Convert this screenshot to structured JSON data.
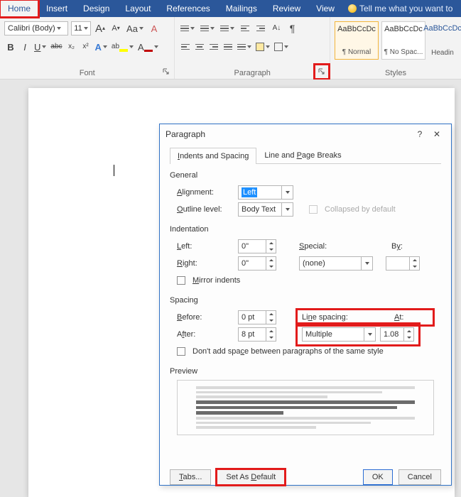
{
  "ribbon": {
    "tabs": {
      "home": "Home",
      "insert": "Insert",
      "design": "Design",
      "layout": "Layout",
      "references": "References",
      "mailings": "Mailings",
      "review": "Review",
      "view": "View"
    },
    "tellme": "Tell me what you want to"
  },
  "font": {
    "group_label": "Font",
    "name_value": "Calibri (Body)",
    "size_value": "11",
    "grow_tip": "A",
    "shrink_tip": "A",
    "changecase": "Aa",
    "clear": "A",
    "bold": "B",
    "italic": "I",
    "underline": "U",
    "strike": "abc",
    "subscript": "x₂",
    "superscript": "x²",
    "texteffects": "A",
    "highlight": "ab",
    "fontcolor": "A"
  },
  "paragraph": {
    "group_label": "Paragraph",
    "pilcrow": "¶"
  },
  "styles": {
    "group_label": "Styles",
    "items": [
      {
        "sample": "AaBbCcDc",
        "name": "¶ Normal"
      },
      {
        "sample": "AaBbCcDc",
        "name": "¶ No Spac..."
      },
      {
        "sample": "AaBbCcDc",
        "name": "Headin"
      }
    ]
  },
  "dialog": {
    "title": "Paragraph",
    "help": "?",
    "close": "✕",
    "tabs": {
      "indents": "Indents and Spacing",
      "breaks": "Line and Page Breaks"
    },
    "general": {
      "heading": "General",
      "alignment_label": "Alignment:",
      "alignment_value": "Left",
      "outline_label": "Outline level:",
      "outline_value": "Body Text",
      "collapsed_label": "Collapsed by default"
    },
    "indent": {
      "heading": "Indentation",
      "left_label": "Left:",
      "left_value": "0\"",
      "right_label": "Right:",
      "right_value": "0\"",
      "special_label": "Special:",
      "special_value": "(none)",
      "by_label": "By:",
      "by_value": "",
      "mirror_label": "Mirror indents"
    },
    "spacing": {
      "heading": "Spacing",
      "before_label": "Before:",
      "before_value": "0 pt",
      "after_label": "After:",
      "after_value": "8 pt",
      "ls_label": "Line spacing:",
      "ls_value": "Multiple",
      "at_label": "At:",
      "at_value": "1.08",
      "noadd_label": "Don't add space between paragraphs of the same style"
    },
    "preview_label": "Preview",
    "buttons": {
      "tabs": "Tabs...",
      "default": "Set As Default",
      "ok": "OK",
      "cancel": "Cancel"
    }
  }
}
